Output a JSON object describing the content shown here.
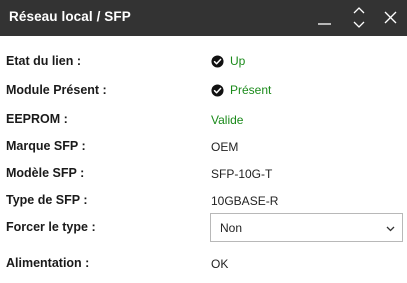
{
  "window": {
    "title": "Réseau local / SFP"
  },
  "colors": {
    "titlebar_bg": "#333333",
    "status_green": "#1a8a1a",
    "icon_black": "#111111"
  },
  "icons": {
    "minimize": "minimize-icon",
    "expand": "expand-collapse-icon",
    "close": "close-icon",
    "status_ok": "check-circle-icon",
    "select_arrow": "chevron-down-icon"
  },
  "fields": {
    "link_state": {
      "label": "Etat du lien :",
      "value": "Up"
    },
    "module_present": {
      "label": "Module Présent :",
      "value": "Présent"
    },
    "eeprom": {
      "label": "EEPROM :",
      "value": "Valide"
    },
    "brand": {
      "label": "Marque SFP :",
      "value": "OEM"
    },
    "model": {
      "label": "Modèle SFP :",
      "value": "SFP-10G-T"
    },
    "type": {
      "label": "Type de SFP :",
      "value": "10GBASE-R"
    },
    "force_type": {
      "label": "Forcer le type :",
      "selected": "Non"
    },
    "power": {
      "label": "Alimentation :",
      "value": "OK"
    }
  }
}
